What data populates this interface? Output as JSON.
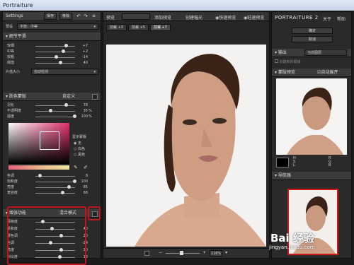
{
  "window": {
    "title": "Portraiture"
  },
  "left": {
    "header": {
      "title": "Settings",
      "save": "保存",
      "delete": "移除"
    },
    "preset": {
      "label": "预设",
      "value": "平衡：中等"
    },
    "detail_section": {
      "title": "细节平滑"
    },
    "detail_sliders": [
      {
        "label": "较细",
        "value": "+7",
        "pos": 0.78
      },
      {
        "label": "中等",
        "value": "+2",
        "pos": 0.7
      },
      {
        "label": "较粗",
        "value": "-14",
        "pos": 0.5
      },
      {
        "label": "阈值",
        "value": "40",
        "pos": 0.62
      }
    ],
    "size": {
      "label": "片值大小",
      "value": "自动检测"
    },
    "skin_section": {
      "title": "肤色蒙版",
      "mode": "自定义"
    },
    "skin_sliders": [
      {
        "label": "羽化",
        "value": "78",
        "unit": "",
        "pos": 0.78
      },
      {
        "label": "不透明度",
        "value": "35",
        "unit": "%",
        "pos": 0.35
      },
      {
        "label": "强度",
        "value": "100",
        "unit": "%",
        "pos": 1.0
      }
    ],
    "mask_options": {
      "title": "显示蒙版",
      "opts": [
        "无",
        "白色",
        "黑色"
      ]
    },
    "hue_sliders": [
      {
        "label": "色调",
        "value": "8",
        "pos": 0.08
      },
      {
        "label": "饱和度",
        "value": "100",
        "pos": 1.0
      },
      {
        "label": "亮度",
        "value": "85",
        "pos": 0.85
      },
      {
        "label": "宽容度",
        "value": "68",
        "pos": 0.68
      }
    ],
    "enhance": {
      "title": "增强功能",
      "subtitle": "混合模式"
    },
    "enhance_sliders": [
      {
        "label": "清晰度",
        "value": "",
        "pos": 0.15
      },
      {
        "label": "柔和度",
        "value": "40",
        "pos": 0.4
      },
      {
        "label": "暖色调",
        "value": "20",
        "pos": 0.65
      },
      {
        "label": "色调",
        "value": "-24",
        "pos": 0.35
      },
      {
        "label": "亮度",
        "value": "20",
        "pos": 0.65
      },
      {
        "label": "对比度",
        "value": "13",
        "pos": 0.6
      }
    ]
  },
  "center": {
    "view_label": "预览",
    "buttons": [
      "添加预览",
      "创建幅光",
      "快速预览",
      "蛀速预览"
    ],
    "tabs": [
      "前裁 +3",
      "前裁 +5",
      "前裁 +7"
    ],
    "zoom": "116%"
  },
  "right": {
    "brand": "PORTRAITURE 2",
    "about": "关于",
    "help": "帮助",
    "ok": "确定",
    "cancel": "取消",
    "output": {
      "label": "输出",
      "value": "当前图层",
      "checkbox": "创建新的蒙版"
    },
    "mask_preview": {
      "title": "蒙版预览",
      "auto": "自动展开"
    },
    "readout_left": [
      "H",
      "S",
      "L"
    ],
    "readout_right": [
      "R",
      "G",
      "B"
    ],
    "navigator": {
      "title": "导航器"
    }
  },
  "watermark": {
    "line1": "Bai 经验",
    "line2": "jingyan.baidu.com"
  },
  "colors": {
    "accent_red": "#c0141b",
    "panel": "#2a2a2a",
    "header": "#3b3b3b"
  }
}
